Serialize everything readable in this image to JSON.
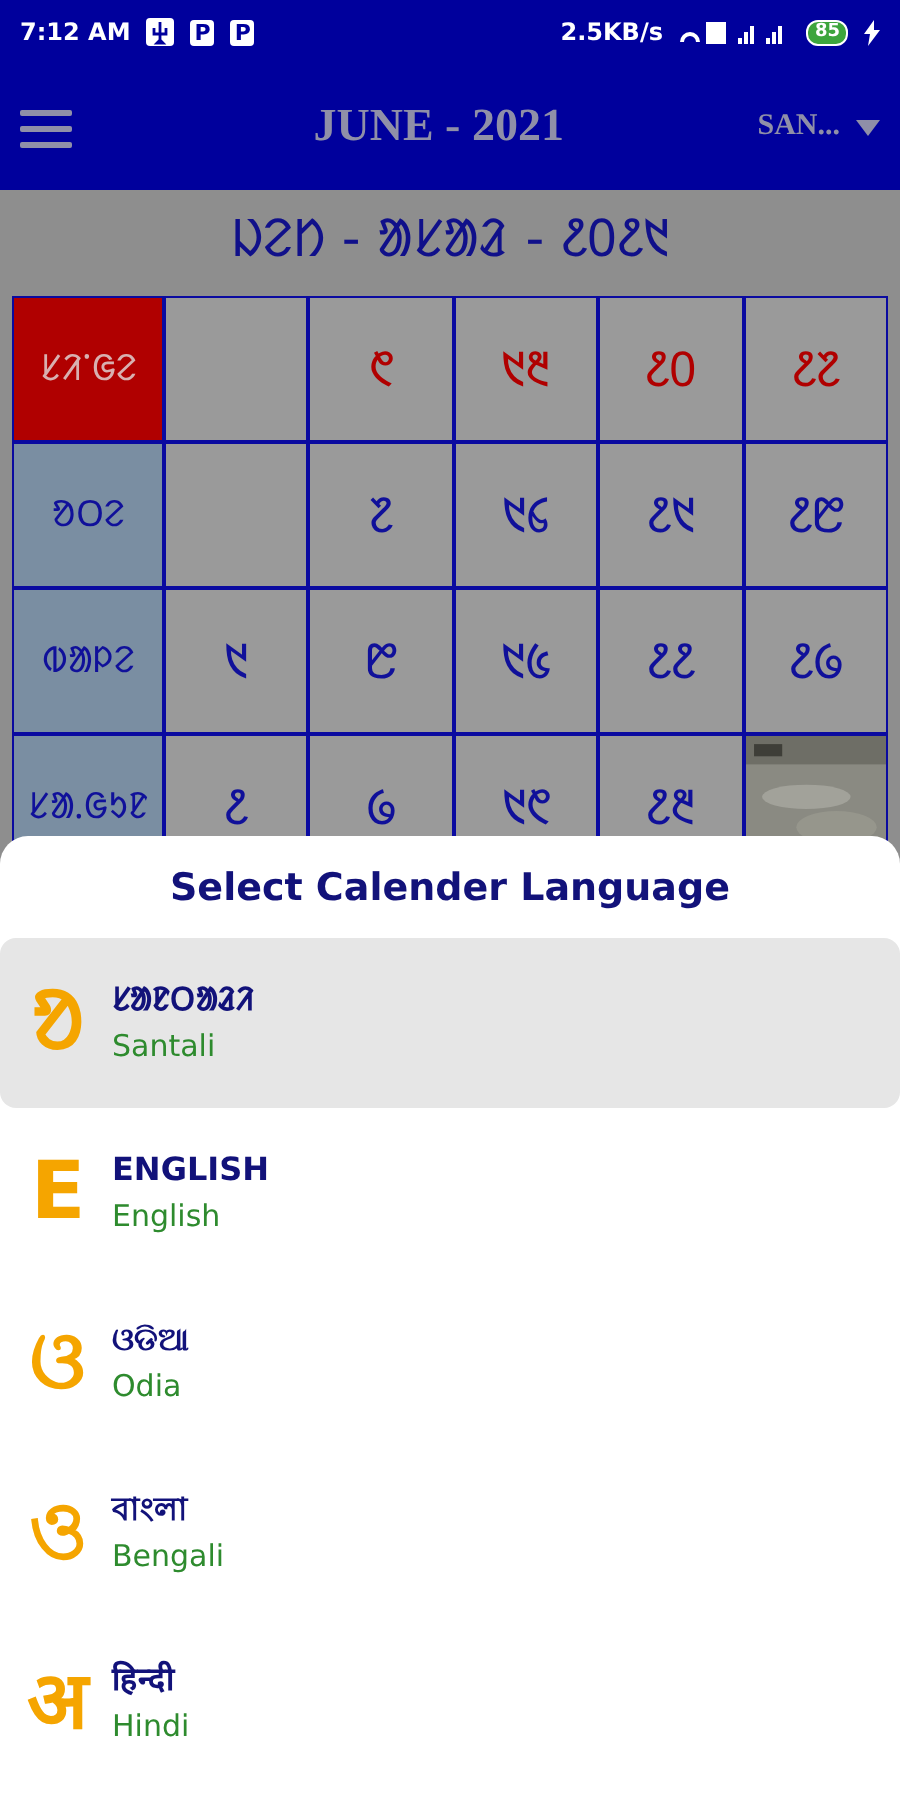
{
  "status_bar": {
    "time": "7:12 AM",
    "notifications": [
      "P",
      "P"
    ],
    "speed": "2.5KB/s",
    "battery": "85"
  },
  "app_bar": {
    "title": "JUNE - 2021",
    "language": "SAN..."
  },
  "month_header": "ᱡᱮᱴ - ᱟᱥᱟᱲ - ᱒᱐᱒᱑",
  "calendar": {
    "rows": [
      {
        "day": "ᱥᱤᱸᱜᱮ",
        "holiday": true,
        "cells": [
          {
            "kind": "empty"
          },
          {
            "kind": "date",
            "text": "᱖"
          },
          {
            "kind": "date",
            "text": "᱑᱓"
          },
          {
            "kind": "date",
            "text": "᱒᱐"
          },
          {
            "kind": "date",
            "text": "᱒᱗"
          }
        ]
      },
      {
        "day": "ᱚᱛᱮ",
        "holiday": false,
        "cells": [
          {
            "kind": "empty"
          },
          {
            "kind": "date",
            "text": "᱗"
          },
          {
            "kind": "date",
            "text": "᱑᱔"
          },
          {
            "kind": "date",
            "text": "᱒᱑"
          },
          {
            "kind": "date",
            "text": "᱒᱘"
          }
        ]
      },
      {
        "day": "ᱵᱟᱞᱮ",
        "holiday": false,
        "cells": [
          {
            "kind": "date",
            "text": "᱑"
          },
          {
            "kind": "date",
            "text": "᱘"
          },
          {
            "kind": "date",
            "text": "᱑᱕"
          },
          {
            "kind": "date",
            "text": "᱒᱒"
          },
          {
            "kind": "date",
            "text": "᱒᱙"
          }
        ]
      },
      {
        "day": "ᱥᱟᱹᱜᱩᱱ",
        "holiday": false,
        "cells": [
          {
            "kind": "date",
            "text": "᱒"
          },
          {
            "kind": "date",
            "text": "᱙"
          },
          {
            "kind": "date",
            "text": "᱑᱖"
          },
          {
            "kind": "date",
            "text": "᱒᱓"
          },
          {
            "kind": "picture"
          }
        ]
      }
    ]
  },
  "language_sheet": {
    "title": "Select Calender Language",
    "items": [
      {
        "glyph": "ᱚ",
        "native": "ᱥᱟᱱᱛᱟᱲᱤ",
        "name": "Santali",
        "selected": true
      },
      {
        "glyph": "E",
        "native": "ENGLISH",
        "name": "English",
        "selected": false
      },
      {
        "glyph": "ଓ",
        "native": "ଓଡିଆ",
        "name": "Odia",
        "selected": false
      },
      {
        "glyph": "ও",
        "native": "বাংলা",
        "name": "Bengali",
        "selected": false
      },
      {
        "glyph": "अ",
        "native": "हिन्दी",
        "name": "Hindi",
        "selected": false
      }
    ]
  }
}
